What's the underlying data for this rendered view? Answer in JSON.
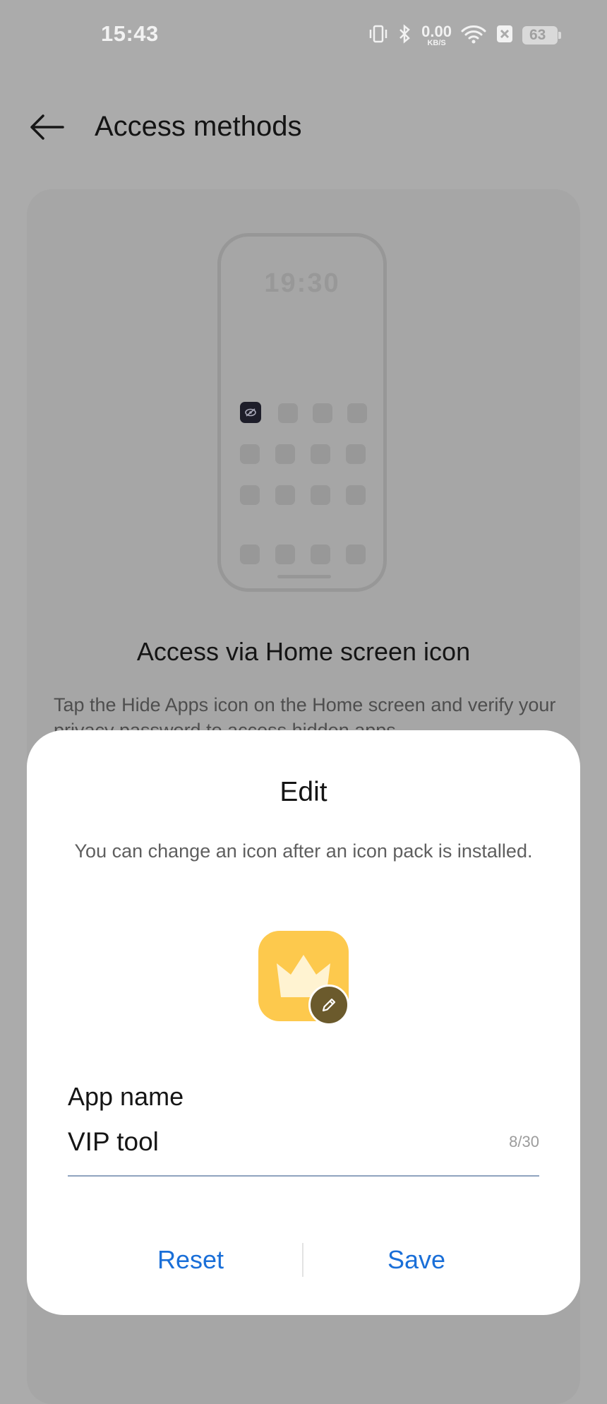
{
  "status_bar": {
    "time": "15:43",
    "net_speed_value": "0.00",
    "net_speed_unit": "KB/S",
    "battery": "63",
    "icons": [
      "vibrate-icon",
      "bluetooth-icon",
      "wifi-icon",
      "sim-off-icon",
      "battery-icon"
    ]
  },
  "header": {
    "back_icon": "arrow-left-icon",
    "title": "Access methods"
  },
  "card": {
    "illustration_time": "19:30",
    "title": "Access via Home screen icon",
    "description": "Tap the Hide Apps icon on the Home screen and verify your privacy password to access hidden apps."
  },
  "dialog": {
    "title": "Edit",
    "subtitle": "You can change an icon after an icon pack is installed.",
    "icon_name": "crown-icon",
    "edit_badge_icon": "pencil-icon",
    "field_label": "App name",
    "field_value": "VIP tool",
    "char_count": "8/30",
    "reset_label": "Reset",
    "save_label": "Save"
  },
  "colors": {
    "accent": "#1a6fd8",
    "icon_bg": "#fdc94d",
    "scrim": "#ababab"
  }
}
